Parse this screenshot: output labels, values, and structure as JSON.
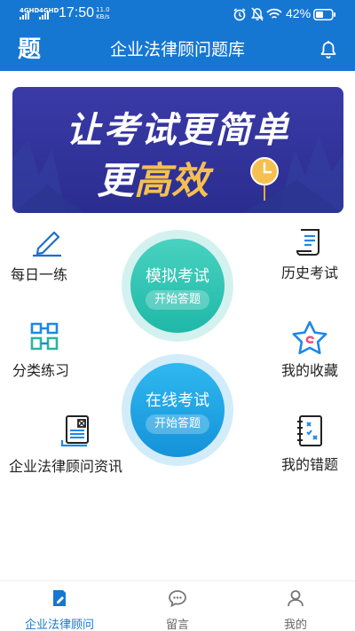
{
  "status_bar": {
    "net1": "4G",
    "net1_sup": "HD",
    "net2": "4G",
    "net2_sup": "HD",
    "time": "17:50",
    "speed_value": "11.0",
    "speed_unit": "KB/s",
    "battery": "42%",
    "icons": [
      "alarm-icon",
      "mute-icon",
      "wifi-icon",
      "battery-icon"
    ]
  },
  "header": {
    "logo": "题",
    "title": "企业法律顾问题库",
    "right_icon": "bell-icon"
  },
  "banner": {
    "line1": "让考试更简单",
    "line2_white": "更",
    "line2_gold": "高效"
  },
  "menu": {
    "daily": "每日一练",
    "history": "历史考试",
    "category": "分类练习",
    "favorites": "我的收藏",
    "news": "企业法律顾问资讯",
    "mistakes": "我的错题"
  },
  "circles": {
    "mock": {
      "title": "模拟考试",
      "button": "开始答题"
    },
    "online": {
      "title": "在线考试",
      "button": "开始答题"
    }
  },
  "bottom_nav": {
    "tabs": [
      {
        "label": "企业法律顾问",
        "icon": "book-edit-icon",
        "active": true
      },
      {
        "label": "留言",
        "icon": "chat-icon",
        "active": false
      },
      {
        "label": "我的",
        "icon": "user-icon",
        "active": false
      }
    ]
  },
  "colors": {
    "primary": "#1677d2",
    "banner_bg": "#2f3098",
    "gold": "#f6c04e",
    "mock_circle": "#38c8b8",
    "online_circle": "#23a7e8"
  }
}
